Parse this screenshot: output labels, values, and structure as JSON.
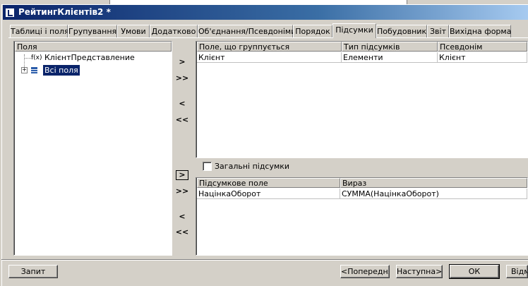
{
  "window": {
    "title": "РейтингКлієнтів2 *"
  },
  "tabs": [
    {
      "label": "Таблиці і поля",
      "active": false
    },
    {
      "label": "Групування",
      "active": false
    },
    {
      "label": "Умови",
      "active": false
    },
    {
      "label": "Додатково",
      "active": false
    },
    {
      "label": "Об'єднання/Псевдоніми",
      "active": false
    },
    {
      "label": "Порядок",
      "active": false
    },
    {
      "label": "Підсумки",
      "active": true
    },
    {
      "label": "Побудовник",
      "active": false
    },
    {
      "label": "Звіт",
      "active": false
    },
    {
      "label": "Вихідна форма",
      "active": false
    }
  ],
  "fields_panel": {
    "header": "Поля",
    "items": [
      {
        "label": "КлієнтПредставление",
        "icon": "function-icon"
      },
      {
        "label": "Всі поля",
        "icon": "table-icon",
        "selected": true
      }
    ]
  },
  "grouping_table": {
    "columns": [
      "Поле, що группується",
      "Тип підсумків",
      "Псевдонім"
    ],
    "rows": [
      [
        "Клієнт",
        "Елементи",
        "Клієнт"
      ]
    ]
  },
  "overall_totals": {
    "label": "Загальні підсумки",
    "checked": false
  },
  "totals_table": {
    "columns": [
      "Підсумкове поле",
      "Вираз"
    ],
    "rows": [
      [
        "НацінкаОборот",
        "СУММА(НацінкаОборот)"
      ]
    ]
  },
  "move_buttons": {
    "add": ">",
    "add_all": ">>",
    "remove": "<",
    "remove_all": "<<"
  },
  "footer": {
    "query_button": "Запит",
    "prev_button": "<Попередня",
    "next_button": "Наступна>",
    "ok_button": "ОК",
    "cancel_button": "Відм"
  }
}
